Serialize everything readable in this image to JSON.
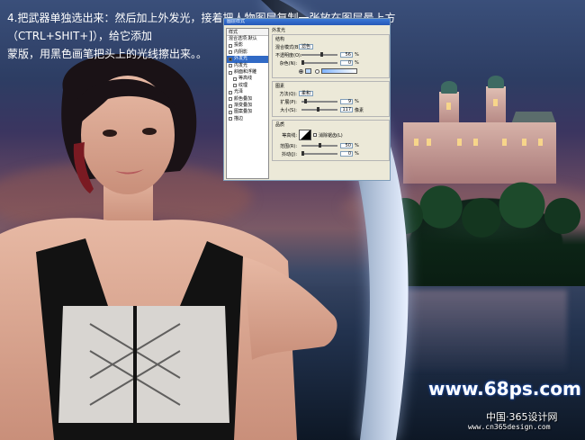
{
  "caption": {
    "line1": "4.把武器单独选出来：然后加上外发光，接着把人物图层复制一张放在图层最上方（CTRL+SHIT+]），给它添加",
    "line2": "蒙版，用黑色画笔把头上的光线擦出来。。"
  },
  "dialog": {
    "title": "图层样式",
    "list_header": "样式",
    "list_items": [
      {
        "label": "混合选项:默认",
        "checked": false,
        "selected": false,
        "sub": false,
        "has_checkbox": false
      },
      {
        "label": "投影",
        "checked": false,
        "selected": false,
        "sub": false,
        "has_checkbox": true
      },
      {
        "label": "内阴影",
        "checked": false,
        "selected": false,
        "sub": false,
        "has_checkbox": true
      },
      {
        "label": "外发光",
        "checked": true,
        "selected": true,
        "sub": false,
        "has_checkbox": true
      },
      {
        "label": "内发光",
        "checked": false,
        "selected": false,
        "sub": false,
        "has_checkbox": true
      },
      {
        "label": "斜面和浮雕",
        "checked": false,
        "selected": false,
        "sub": false,
        "has_checkbox": true
      },
      {
        "label": "等高线",
        "checked": false,
        "selected": false,
        "sub": true,
        "has_checkbox": true
      },
      {
        "label": "纹理",
        "checked": false,
        "selected": false,
        "sub": true,
        "has_checkbox": true
      },
      {
        "label": "光泽",
        "checked": false,
        "selected": false,
        "sub": false,
        "has_checkbox": true
      },
      {
        "label": "颜色叠加",
        "checked": false,
        "selected": false,
        "sub": false,
        "has_checkbox": true
      },
      {
        "label": "渐变叠加",
        "checked": false,
        "selected": false,
        "sub": false,
        "has_checkbox": true
      },
      {
        "label": "图案叠加",
        "checked": false,
        "selected": false,
        "sub": false,
        "has_checkbox": true
      },
      {
        "label": "描边",
        "checked": false,
        "selected": false,
        "sub": false,
        "has_checkbox": true
      }
    ],
    "outer_glow": {
      "section_title": "外发光",
      "structure": {
        "title": "结构",
        "blend_mode_label": "混合模式(B):",
        "blend_mode_value": "滤色",
        "opacity_label": "不透明度(O):",
        "opacity_value": "56",
        "opacity_fraction": 0.56,
        "noise_label": "杂色(N):",
        "noise_value": "0",
        "noise_fraction": 0.0,
        "unit": "%"
      },
      "elements": {
        "title": "图素",
        "technique_label": "方法(Q):",
        "technique_value": "柔和",
        "spread_label": "扩展(P):",
        "spread_value": "9",
        "spread_fraction": 0.09,
        "size_label": "大小(S):",
        "size_value": "117",
        "size_fraction": 0.47,
        "size_unit": "像素",
        "unit": "%"
      },
      "quality": {
        "title": "品质",
        "contour_label": "等高线:",
        "anti_alias_label": "消除锯齿(L)",
        "range_label": "范围(R):",
        "range_value": "50",
        "range_fraction": 0.5,
        "jitter_label": "抖动(J):",
        "jitter_value": "0",
        "jitter_fraction": 0.0,
        "unit": "%"
      }
    }
  },
  "watermark": {
    "site": "www.68ps.com",
    "cn": "中国·365设计网",
    "url": "www.cn365design.com"
  }
}
